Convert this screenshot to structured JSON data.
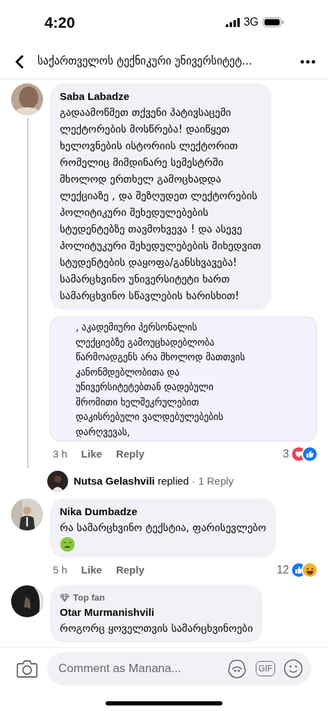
{
  "status_bar": {
    "time": "4:20",
    "network": "3G"
  },
  "header": {
    "title": "საქართველოს ტექნიკური უნივერსიტეტ..."
  },
  "comments": [
    {
      "author": "Saba Labadze",
      "text": "გადაამოწმეთ თქვენი პატივსაცემი\nლექტორების მოსწრება! დაიწყეთ\nხელოვნების ისტორიის ლექტორით\nრომელიც მიმდინარე სემესტრში\nმხოლოდ ერთხელ გამოცხადდა\nლექციაზე , და შეზღუდეთ ლექტორების\nპოლიტიკური შეხედულებების\nსტუდენტებზე თავმოხვევა ! და ასევე\nპოლიტუკური შეხედულებების მიხედვით\nსტუდენტების დაყოფა/განსხვავება!\nსამარცხვინო უნივერსიტეტი ხართ\nსამარცხვინო სწავლების ხარისხით!",
      "attachment": {
        "text": ", აკადემიური პერსონალის\nლექციებზე გამოუცხადებლობა\nწარმოადგენს არა მხოლოდ მათთვის\nკანონმდებლობითა და\nუნივერსიტეტებთან დადებული\nშრომითი ხელშეკრულებით\nდაკისრებული ვალდებულებების\nდარღვევას,"
      },
      "time": "3 h",
      "like": "Like",
      "reply": "Reply",
      "reaction_count": "3",
      "reactions": [
        {
          "kind": "love"
        },
        {
          "kind": "like"
        }
      ],
      "replies": {
        "author": "Nutsa Gelashvili",
        "action": "replied",
        "separator": "·",
        "count": "1 Reply"
      }
    },
    {
      "author": "Nika Dumbadze",
      "text": "რა სამარცხვინო ტექსტია, ფარისევლებო",
      "emoji": {
        "kind": "sick"
      },
      "time": "5 h",
      "like": "Like",
      "reply": "Reply",
      "reaction_count": "12",
      "reactions": [
        {
          "kind": "like"
        },
        {
          "kind": "haha"
        }
      ]
    },
    {
      "author": "Otar Murmanishvili",
      "badge": "Top fan",
      "text": "როგორც ყოველთვის სამარცხვინოები"
    }
  ],
  "composer": {
    "placeholder": "Comment as Manana...",
    "gif_label": "GIF"
  }
}
